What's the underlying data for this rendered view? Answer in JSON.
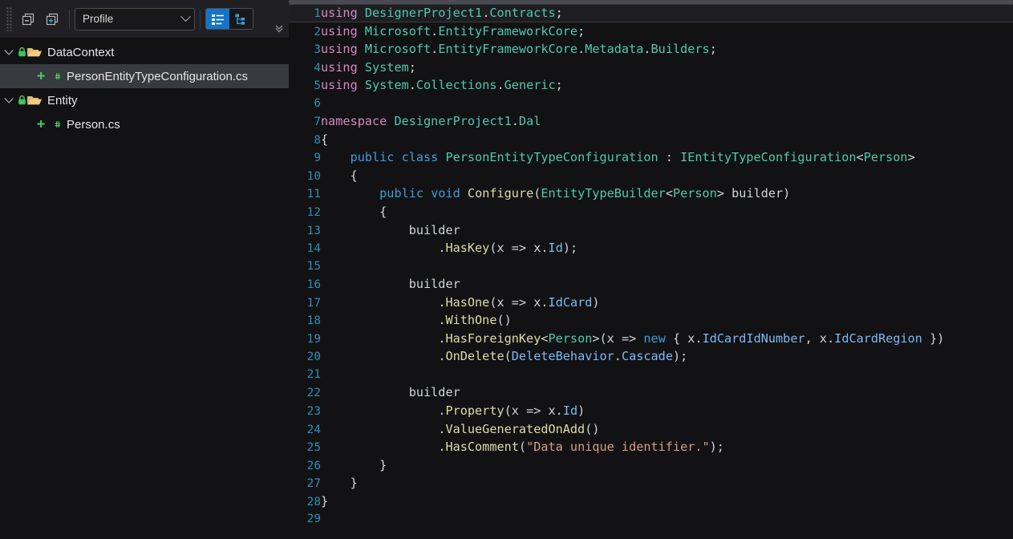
{
  "toolbar": {
    "collapse_all_label": "Collapse All",
    "expand_all_label": "Expand All",
    "profile_value": "Profile",
    "profile_placeholder": "Profile",
    "list_view_label": "Flat List View",
    "tree_view_label": "Hierarchy View",
    "overflow_label": "More"
  },
  "tree": {
    "items": [
      {
        "label": "DataContext",
        "kind": "folder",
        "depth": 0,
        "expanded": true,
        "selected": false,
        "locked": true,
        "added": false
      },
      {
        "label": "PersonEntityTypeConfiguration.cs",
        "kind": "csharp",
        "depth": 1,
        "expanded": false,
        "selected": true,
        "locked": false,
        "added": true
      },
      {
        "label": "Entity",
        "kind": "folder",
        "depth": 0,
        "expanded": true,
        "selected": false,
        "locked": true,
        "added": false
      },
      {
        "label": "Person.cs",
        "kind": "csharp",
        "depth": 1,
        "expanded": false,
        "selected": false,
        "locked": false,
        "added": true
      }
    ]
  },
  "editor": {
    "current_line": 1,
    "lines": [
      {
        "n": "1",
        "tokens": [
          {
            "t": "using",
            "c": "k"
          },
          {
            "t": " ",
            "c": "p"
          },
          {
            "t": "DesignerProject1",
            "c": "ns"
          },
          {
            "t": ".",
            "c": "p"
          },
          {
            "t": "Contracts",
            "c": "ns"
          },
          {
            "t": ";",
            "c": "p"
          }
        ]
      },
      {
        "n": "2",
        "tokens": [
          {
            "t": "using",
            "c": "k"
          },
          {
            "t": " ",
            "c": "p"
          },
          {
            "t": "Microsoft",
            "c": "ns"
          },
          {
            "t": ".",
            "c": "p"
          },
          {
            "t": "EntityFrameworkCore",
            "c": "ns"
          },
          {
            "t": ";",
            "c": "p"
          }
        ]
      },
      {
        "n": "3",
        "tokens": [
          {
            "t": "using",
            "c": "k"
          },
          {
            "t": " ",
            "c": "p"
          },
          {
            "t": "Microsoft",
            "c": "ns"
          },
          {
            "t": ".",
            "c": "p"
          },
          {
            "t": "EntityFrameworkCore",
            "c": "ns"
          },
          {
            "t": ".",
            "c": "p"
          },
          {
            "t": "Metadata",
            "c": "ns"
          },
          {
            "t": ".",
            "c": "p"
          },
          {
            "t": "Builders",
            "c": "ns"
          },
          {
            "t": ";",
            "c": "p"
          }
        ]
      },
      {
        "n": "4",
        "tokens": [
          {
            "t": "using",
            "c": "k"
          },
          {
            "t": " ",
            "c": "p"
          },
          {
            "t": "System",
            "c": "ns"
          },
          {
            "t": ";",
            "c": "p"
          }
        ]
      },
      {
        "n": "5",
        "tokens": [
          {
            "t": "using",
            "c": "k"
          },
          {
            "t": " ",
            "c": "p"
          },
          {
            "t": "System",
            "c": "ns"
          },
          {
            "t": ".",
            "c": "p"
          },
          {
            "t": "Collections",
            "c": "ns"
          },
          {
            "t": ".",
            "c": "p"
          },
          {
            "t": "Generic",
            "c": "ns"
          },
          {
            "t": ";",
            "c": "p"
          }
        ]
      },
      {
        "n": "6",
        "tokens": []
      },
      {
        "n": "7",
        "tokens": [
          {
            "t": "namespace",
            "c": "k"
          },
          {
            "t": " ",
            "c": "p"
          },
          {
            "t": "DesignerProject1",
            "c": "ns"
          },
          {
            "t": ".",
            "c": "p"
          },
          {
            "t": "Dal",
            "c": "ns"
          }
        ]
      },
      {
        "n": "8",
        "tokens": [
          {
            "t": "{",
            "c": "br1"
          }
        ]
      },
      {
        "n": "9",
        "tokens": [
          {
            "t": "    ",
            "c": "p"
          },
          {
            "t": "public",
            "c": "kb"
          },
          {
            "t": " ",
            "c": "p"
          },
          {
            "t": "class",
            "c": "kb"
          },
          {
            "t": " ",
            "c": "p"
          },
          {
            "t": "PersonEntityTypeConfiguration",
            "c": "typ"
          },
          {
            "t": " : ",
            "c": "p"
          },
          {
            "t": "IEntityTypeConfiguration",
            "c": "typ"
          },
          {
            "t": "<",
            "c": "p"
          },
          {
            "t": "Person",
            "c": "typ"
          },
          {
            "t": ">",
            "c": "p"
          }
        ]
      },
      {
        "n": "10",
        "tokens": [
          {
            "t": "    ",
            "c": "p"
          },
          {
            "t": "{",
            "c": "br1"
          }
        ]
      },
      {
        "n": "11",
        "tokens": [
          {
            "t": "        ",
            "c": "p"
          },
          {
            "t": "public",
            "c": "kb"
          },
          {
            "t": " ",
            "c": "p"
          },
          {
            "t": "void",
            "c": "kb"
          },
          {
            "t": " ",
            "c": "p"
          },
          {
            "t": "Configure",
            "c": "mth"
          },
          {
            "t": "(",
            "c": "p"
          },
          {
            "t": "EntityTypeBuilder",
            "c": "typ"
          },
          {
            "t": "<",
            "c": "p"
          },
          {
            "t": "Person",
            "c": "typ"
          },
          {
            "t": "> ",
            "c": "p"
          },
          {
            "t": "builder",
            "c": "var"
          },
          {
            "t": ")",
            "c": "p"
          }
        ]
      },
      {
        "n": "12",
        "tokens": [
          {
            "t": "        ",
            "c": "p"
          },
          {
            "t": "{",
            "c": "br1"
          }
        ]
      },
      {
        "n": "13",
        "tokens": [
          {
            "t": "            ",
            "c": "p"
          },
          {
            "t": "builder",
            "c": "var"
          }
        ]
      },
      {
        "n": "14",
        "tokens": [
          {
            "t": "                ",
            "c": "p"
          },
          {
            "t": ".",
            "c": "p"
          },
          {
            "t": "HasKey",
            "c": "mth"
          },
          {
            "t": "(",
            "c": "p"
          },
          {
            "t": "x",
            "c": "var"
          },
          {
            "t": " => ",
            "c": "p"
          },
          {
            "t": "x",
            "c": "var"
          },
          {
            "t": ".",
            "c": "p"
          },
          {
            "t": "Id",
            "c": "prop"
          },
          {
            "t": ");",
            "c": "p"
          }
        ]
      },
      {
        "n": "15",
        "tokens": []
      },
      {
        "n": "16",
        "tokens": [
          {
            "t": "            ",
            "c": "p"
          },
          {
            "t": "builder",
            "c": "var"
          }
        ]
      },
      {
        "n": "17",
        "tokens": [
          {
            "t": "                ",
            "c": "p"
          },
          {
            "t": ".",
            "c": "p"
          },
          {
            "t": "HasOne",
            "c": "mth"
          },
          {
            "t": "(",
            "c": "p"
          },
          {
            "t": "x",
            "c": "var"
          },
          {
            "t": " => ",
            "c": "p"
          },
          {
            "t": "x",
            "c": "var"
          },
          {
            "t": ".",
            "c": "p"
          },
          {
            "t": "IdCard",
            "c": "prop"
          },
          {
            "t": ")",
            "c": "p"
          }
        ]
      },
      {
        "n": "18",
        "tokens": [
          {
            "t": "                ",
            "c": "p"
          },
          {
            "t": ".",
            "c": "p"
          },
          {
            "t": "WithOne",
            "c": "mth"
          },
          {
            "t": "()",
            "c": "p"
          }
        ]
      },
      {
        "n": "19",
        "tokens": [
          {
            "t": "                ",
            "c": "p"
          },
          {
            "t": ".",
            "c": "p"
          },
          {
            "t": "HasForeignKey",
            "c": "mth"
          },
          {
            "t": "<",
            "c": "p"
          },
          {
            "t": "Person",
            "c": "typ"
          },
          {
            "t": ">(",
            "c": "p"
          },
          {
            "t": "x",
            "c": "var"
          },
          {
            "t": " => ",
            "c": "p"
          },
          {
            "t": "new",
            "c": "kb"
          },
          {
            "t": " { ",
            "c": "p"
          },
          {
            "t": "x",
            "c": "var"
          },
          {
            "t": ".",
            "c": "p"
          },
          {
            "t": "IdCardIdNumber",
            "c": "prop"
          },
          {
            "t": ", ",
            "c": "p"
          },
          {
            "t": "x",
            "c": "var"
          },
          {
            "t": ".",
            "c": "p"
          },
          {
            "t": "IdCardRegion",
            "c": "prop"
          },
          {
            "t": " })",
            "c": "p"
          }
        ]
      },
      {
        "n": "20",
        "tokens": [
          {
            "t": "                ",
            "c": "p"
          },
          {
            "t": ".",
            "c": "p"
          },
          {
            "t": "OnDelete",
            "c": "mth"
          },
          {
            "t": "(",
            "c": "p"
          },
          {
            "t": "DeleteBehavior",
            "c": "prop"
          },
          {
            "t": ".",
            "c": "p"
          },
          {
            "t": "Cascade",
            "c": "prop"
          },
          {
            "t": ");",
            "c": "p"
          }
        ]
      },
      {
        "n": "21",
        "tokens": []
      },
      {
        "n": "22",
        "tokens": [
          {
            "t": "            ",
            "c": "p"
          },
          {
            "t": "builder",
            "c": "var"
          }
        ]
      },
      {
        "n": "23",
        "tokens": [
          {
            "t": "                ",
            "c": "p"
          },
          {
            "t": ".",
            "c": "p"
          },
          {
            "t": "Property",
            "c": "mth"
          },
          {
            "t": "(",
            "c": "p"
          },
          {
            "t": "x",
            "c": "var"
          },
          {
            "t": " => ",
            "c": "p"
          },
          {
            "t": "x",
            "c": "var"
          },
          {
            "t": ".",
            "c": "p"
          },
          {
            "t": "Id",
            "c": "prop"
          },
          {
            "t": ")",
            "c": "p"
          }
        ]
      },
      {
        "n": "24",
        "tokens": [
          {
            "t": "                ",
            "c": "p"
          },
          {
            "t": ".",
            "c": "p"
          },
          {
            "t": "ValueGeneratedOnAdd",
            "c": "mth"
          },
          {
            "t": "()",
            "c": "p"
          }
        ]
      },
      {
        "n": "25",
        "tokens": [
          {
            "t": "                ",
            "c": "p"
          },
          {
            "t": ".",
            "c": "p"
          },
          {
            "t": "HasComment",
            "c": "mth"
          },
          {
            "t": "(",
            "c": "p"
          },
          {
            "t": "\"Data unique identifier.\"",
            "c": "str"
          },
          {
            "t": ");",
            "c": "p"
          }
        ]
      },
      {
        "n": "26",
        "tokens": [
          {
            "t": "        ",
            "c": "p"
          },
          {
            "t": "}",
            "c": "br1"
          }
        ]
      },
      {
        "n": "27",
        "tokens": [
          {
            "t": "    ",
            "c": "p"
          },
          {
            "t": "}",
            "c": "br1"
          }
        ]
      },
      {
        "n": "28",
        "tokens": [
          {
            "t": "}",
            "c": "br1"
          }
        ]
      },
      {
        "n": "29",
        "tokens": []
      }
    ]
  },
  "colors": {
    "accent": "#1573c8",
    "folder": "#e0bb72",
    "csharp": "#4fc36a",
    "lock": "#3cc653",
    "add": "#4fc36a",
    "gutter": "#2f8fb8",
    "editor_bg": "#121214",
    "toolbar_bg": "#202024",
    "selection": "#373a3e"
  }
}
